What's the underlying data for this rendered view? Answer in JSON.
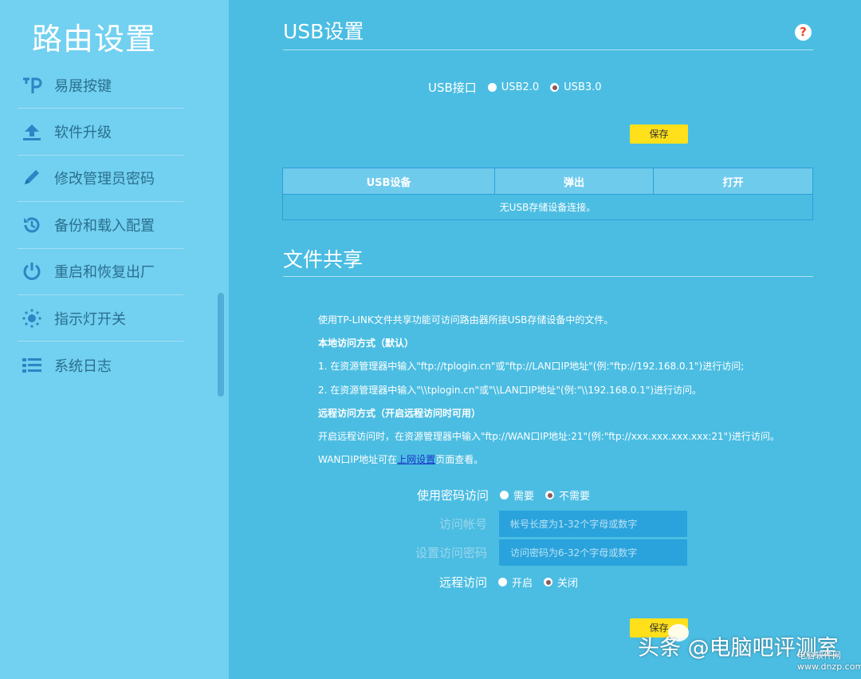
{
  "sidebar": {
    "title": "路由设置",
    "items": [
      {
        "label": "易展按键",
        "icon": "tp-icon"
      },
      {
        "label": "软件升级",
        "icon": "upload-icon"
      },
      {
        "label": "修改管理员密码",
        "icon": "pencil-icon"
      },
      {
        "label": "备份和载入配置",
        "icon": "history-icon"
      },
      {
        "label": "重启和恢复出厂",
        "icon": "power-icon"
      },
      {
        "label": "指示灯开关",
        "icon": "light-icon"
      },
      {
        "label": "系统日志",
        "icon": "list-icon"
      }
    ]
  },
  "usb": {
    "title": "USB设置",
    "port_label": "USB接口",
    "options": [
      "USB2.0",
      "USB3.0"
    ],
    "selected": "USB3.0",
    "save_label": "保存",
    "table": {
      "headers": [
        "USB设备",
        "弹出",
        "打开"
      ],
      "empty_text": "无USB存储设备连接。"
    }
  },
  "share": {
    "title": "文件共享",
    "intro": "使用TP-LINK文件共享功能可访问路由器所接USB存储设备中的文件。",
    "local_heading": "本地访问方式（默认）",
    "local_1": "1. 在资源管理器中输入\"ftp://tplogin.cn\"或\"ftp://LAN口IP地址\"(例:\"ftp://192.168.0.1\")进行访问;",
    "local_2": "2. 在资源管理器中输入\"\\\\tplogin.cn\"或\"\\\\LAN口IP地址\"(例:\"\\\\192.168.0.1\")进行访问。",
    "remote_heading": "远程访问方式（开启远程访问时可用）",
    "remote_1": "开启远程访问时，在资源管理器中输入\"ftp://WAN口IP地址:21\"(例:\"ftp://xxx.xxx.xxx.xxx:21\")进行访问。",
    "wan_prefix": "WAN口IP地址可在",
    "wan_link": "上网设置",
    "wan_suffix": "页面查看。",
    "password_label": "使用密码访问",
    "password_options": [
      "需要",
      "不需要"
    ],
    "password_selected": "不需要",
    "account_label": "访问帐号",
    "account_placeholder": "帐号长度为1-32个字母或数字",
    "passwd_label": "设置访问密码",
    "passwd_placeholder": "访问密码为6-32个字母或数字",
    "remote_label": "远程访问",
    "remote_options": [
      "开启",
      "关闭"
    ],
    "remote_selected": "关闭",
    "save_label": "保存"
  },
  "watermark": {
    "text": "头条 @电脑吧评测室",
    "site_name": "电脑软件网",
    "site_url": "www.dnzp.com"
  }
}
